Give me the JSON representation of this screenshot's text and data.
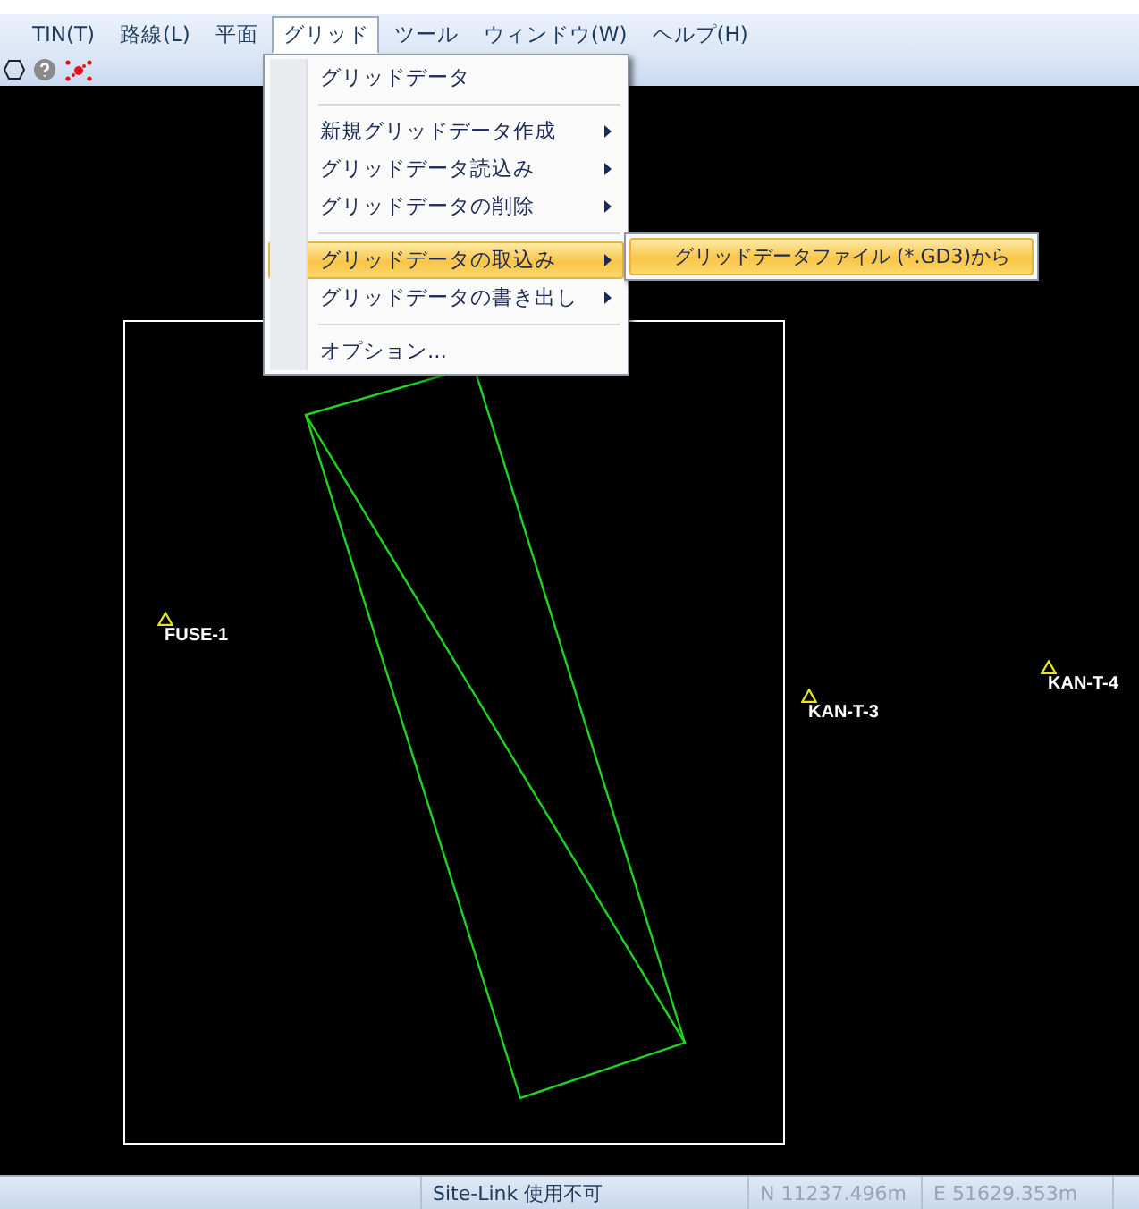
{
  "menu_bar": [
    {
      "label": "TIN(T)",
      "selected": false
    },
    {
      "label": "路線(L)",
      "selected": false
    },
    {
      "label": "平面",
      "selected": false
    },
    {
      "label": "グリッド",
      "selected": true
    },
    {
      "label": "ツール",
      "selected": false
    },
    {
      "label": "ウィンドウ(W)",
      "selected": false
    },
    {
      "label": "ヘルプ(H)",
      "selected": false
    }
  ],
  "toolbar": [
    {
      "kind": "hexagon"
    },
    {
      "kind": "help"
    },
    {
      "kind": "points"
    }
  ],
  "canvas": {
    "stations": [
      {
        "label": "FUSE-1"
      },
      {
        "label": "KAN-T-3"
      },
      {
        "label": "KAN-T-4"
      }
    ]
  },
  "menu": {
    "items": [
      {
        "kind": "item",
        "label": "グリッドデータ",
        "submenu": false,
        "selected": false
      },
      {
        "kind": "separator"
      },
      {
        "kind": "item",
        "label": "新規グリッドデータ作成",
        "submenu": true,
        "selected": false
      },
      {
        "kind": "item",
        "label": "グリッドデータ読込み",
        "submenu": true,
        "selected": false
      },
      {
        "kind": "item",
        "label": "グリッドデータの削除",
        "submenu": true,
        "selected": false
      },
      {
        "kind": "separator"
      },
      {
        "kind": "item",
        "label": "グリッドデータの取込み",
        "submenu": true,
        "selected": true
      },
      {
        "kind": "item",
        "label": "グリッドデータの書き出し",
        "submenu": true,
        "selected": false
      },
      {
        "kind": "separator"
      },
      {
        "kind": "item",
        "label": "オプション...",
        "submenu": false,
        "selected": false
      }
    ]
  },
  "submenu": {
    "items": [
      {
        "label": "グリッドデータファイル (*.GD3)から",
        "selected": true
      }
    ]
  },
  "status_bar": [
    {
      "text": "Site-Link 使用不可",
      "disabled": false
    },
    {
      "text": "N 11237.496m",
      "disabled": true
    },
    {
      "text": "E 51629.353m",
      "disabled": true
    }
  ]
}
